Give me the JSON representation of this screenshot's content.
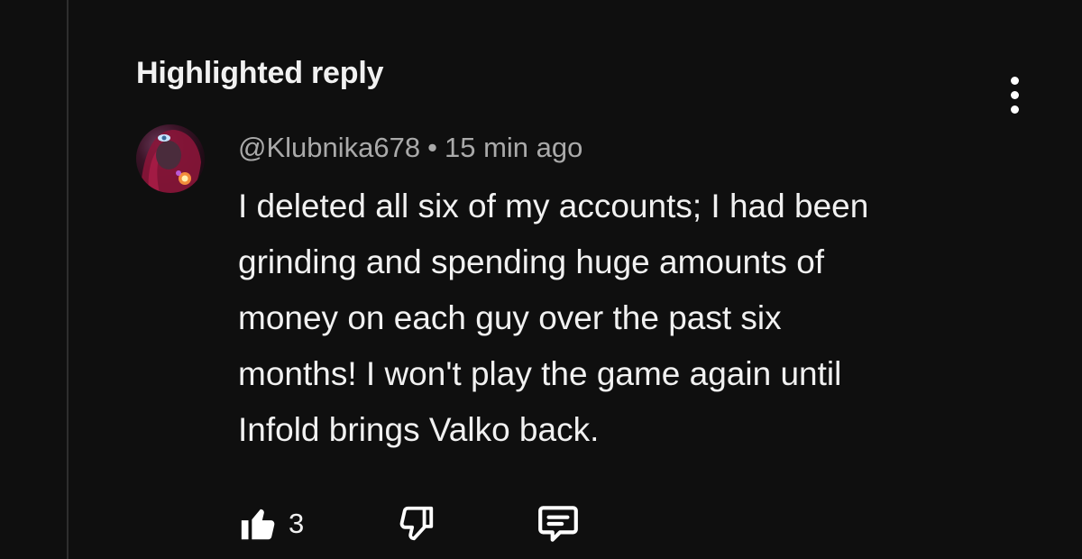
{
  "header": {
    "title": "Highlighted reply"
  },
  "comment": {
    "author": "@Klubnika678",
    "separator": "•",
    "timestamp": "15 min ago",
    "text_lines": [
      "I deleted all six of my accounts; I had been",
      "grinding and spending huge amounts of",
      "money on each guy over the past six",
      "months! I won't play the game again until",
      "Infold brings Valko back."
    ],
    "like_count": "3"
  },
  "icons": {
    "more": "more-vert-icon",
    "like": "thumbs-up-icon",
    "dislike": "thumbs-down-icon",
    "reply": "comment-icon"
  },
  "colors": {
    "background": "#0f0f0f",
    "primary_text": "#f1f1f1",
    "secondary_text": "#aaaaaa"
  }
}
